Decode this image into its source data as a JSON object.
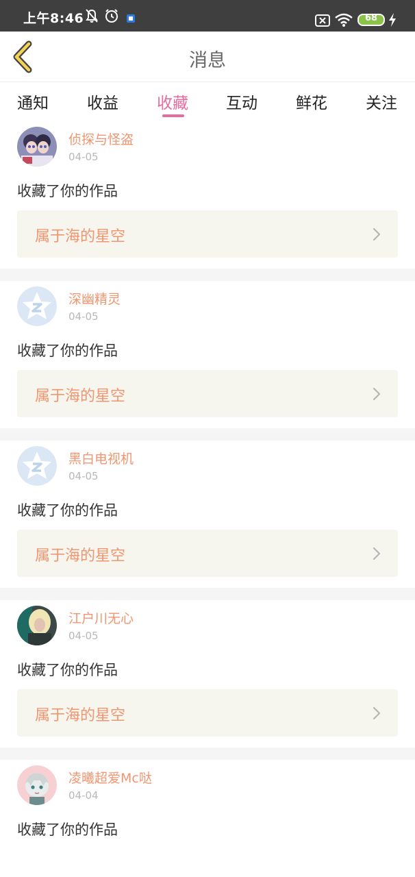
{
  "status_bar": {
    "time": "上午8:46",
    "battery": "68",
    "icons": [
      "bell-off-icon",
      "alarm-icon",
      "app-notification-icon",
      "sim-x-icon",
      "wifi-icon",
      "battery-icon",
      "charging-icon"
    ]
  },
  "header": {
    "title": "消息",
    "back_icon": "chevron-left-icon"
  },
  "tabs": [
    {
      "label": "通知",
      "active": false
    },
    {
      "label": "收益",
      "active": false
    },
    {
      "label": "收藏",
      "active": true
    },
    {
      "label": "互动",
      "active": false
    },
    {
      "label": "鲜花",
      "active": false
    },
    {
      "label": "关注",
      "active": false
    }
  ],
  "colors": {
    "accent": "#e56ba1",
    "username": "#f0956f",
    "card_bg": "#f6f5ee",
    "status_bar": "#3f3f3f"
  },
  "items": [
    {
      "user": "侦探与怪盗",
      "date": "04-05",
      "action": "收藏了你的作品",
      "work": "属于海的星空",
      "avatar": "anime-avatar"
    },
    {
      "user": "深幽精灵",
      "date": "04-05",
      "action": "收藏了你的作品",
      "work": "属于海的星空",
      "avatar": "default-star-avatar"
    },
    {
      "user": "黑白电视机",
      "date": "04-05",
      "action": "收藏了你的作品",
      "work": "属于海的星空",
      "avatar": "default-star-avatar"
    },
    {
      "user": "江户川无心",
      "date": "04-05",
      "action": "收藏了你的作品",
      "work": "属于海的星空",
      "avatar": "photo-avatar"
    },
    {
      "user": "凌曦超爱Mc哒",
      "date": "04-04",
      "action": "收藏了你的作品",
      "work": "",
      "avatar": "cartoon-avatar"
    }
  ]
}
